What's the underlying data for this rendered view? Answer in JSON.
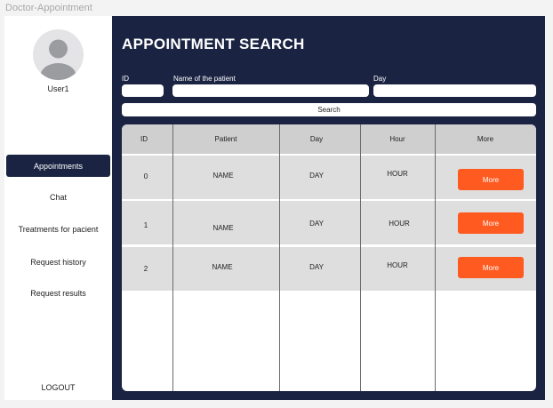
{
  "window": {
    "title": "Doctor-Appointment"
  },
  "sidebar": {
    "user": "User1",
    "items": [
      {
        "label": "Appointments",
        "active": true
      },
      {
        "label": "Chat",
        "active": false
      },
      {
        "label": "Treatments for pacient",
        "active": false
      },
      {
        "label": "Request history",
        "active": false
      },
      {
        "label": "Request results",
        "active": false
      }
    ],
    "logout": "LOGOUT"
  },
  "main": {
    "title": "APPOINTMENT SEARCH",
    "filters": {
      "id_label": "ID",
      "patient_label": "Name of the patient",
      "day_label": "Day",
      "id_value": "",
      "patient_value": "",
      "day_value": ""
    },
    "search_label": "Search"
  },
  "table": {
    "headers": [
      "ID",
      "Patient",
      "Day",
      "Hour",
      "More"
    ],
    "rows": [
      {
        "id": "0",
        "patient": "NAME",
        "day": "DAY",
        "hour": "HOUR",
        "more": "More"
      },
      {
        "id": "1",
        "patient": "NAME",
        "day": "DAY",
        "hour": "HOUR",
        "more": "More"
      },
      {
        "id": "2",
        "patient": "NAME",
        "day": "DAY",
        "hour": "HOUR",
        "more": "More"
      }
    ]
  },
  "colors": {
    "navy": "#1a2442",
    "accent": "#ff5a1f",
    "header_gray": "#cfcfcf",
    "row_gray": "#dedede"
  },
  "icons": {
    "avatar": "user-avatar-icon"
  }
}
